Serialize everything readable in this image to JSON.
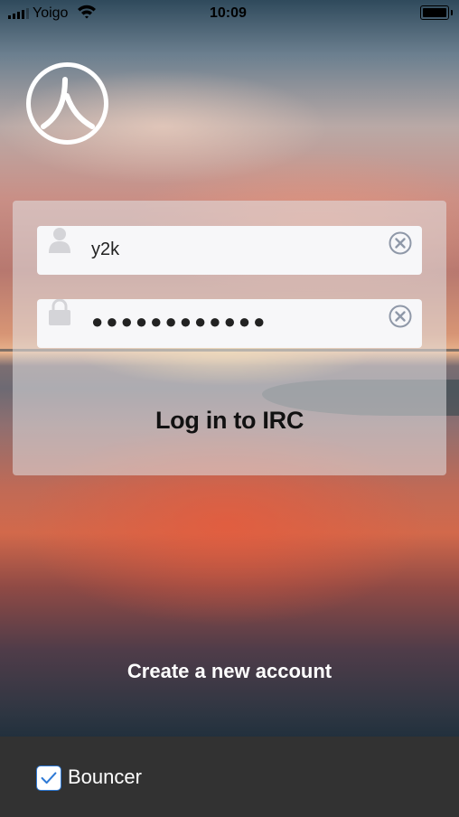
{
  "status_bar": {
    "carrier": "Yoigo",
    "time": "10:09",
    "icons": [
      "signal-icon",
      "wifi-icon",
      "battery-icon"
    ],
    "battery_level": 0.85
  },
  "logo": {
    "icon": "irc-logo-icon"
  },
  "login": {
    "username_value": "y2k",
    "password_value": "●●●●●●●●●●●●",
    "username_icon": "user-icon",
    "password_icon": "lock-icon",
    "clear_icon": "clear-icon",
    "submit_label": "Log in to IRC"
  },
  "create_account_label": "Create a new account",
  "footer": {
    "bouncer_label": "Bouncer",
    "bouncer_checked": true,
    "accent_color": "#2e7ad6"
  }
}
